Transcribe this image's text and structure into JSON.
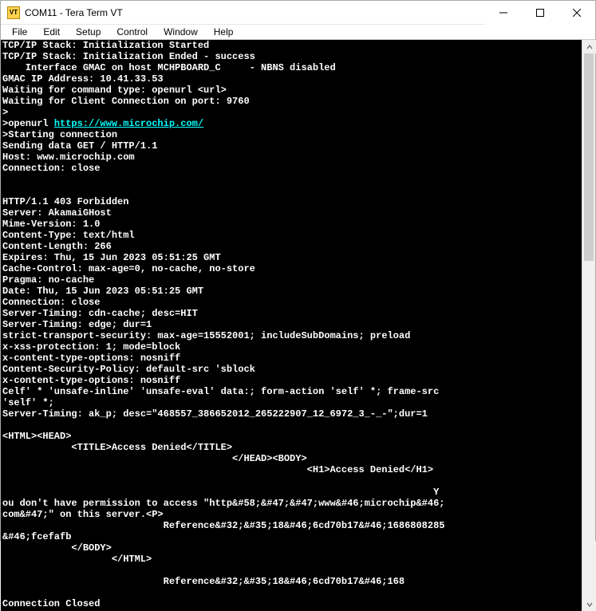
{
  "window": {
    "app_icon_label": "VT",
    "title": "COM11 - Tera Term VT"
  },
  "menu": {
    "items": [
      "File",
      "Edit",
      "Setup",
      "Control",
      "Window",
      "Help"
    ]
  },
  "terminal": {
    "pre1": "TCP/IP Stack: Initialization Started\nTCP/IP Stack: Initialization Ended - success\n    Interface GMAC on host MCHPBOARD_C     - NBNS disabled\nGMAC IP Address: 10.41.33.53\nWaiting for command type: openurl <url>\nWaiting for Client Connection on port: 9760\n>\n>openurl ",
    "link": "https://www.microchip.com/",
    "pre2": "\n>Starting connection\nSending data GET / HTTP/1.1\nHost: www.microchip.com\nConnection: close\n\n\nHTTP/1.1 403 Forbidden\nServer: AkamaiGHost\nMime-Version: 1.0\nContent-Type: text/html\nContent-Length: 266\nExpires: Thu, 15 Jun 2023 05:51:25 GMT\nCache-Control: max-age=0, no-cache, no-store\nPragma: no-cache\nDate: Thu, 15 Jun 2023 05:51:25 GMT\nConnection: close\nServer-Timing: cdn-cache; desc=HIT\nServer-Timing: edge; dur=1\nstrict-transport-security: max-age=15552001; includeSubDomains; preload\nx-xss-protection: 1; mode=block\nx-content-type-options: nosniff\nContent-Security-Policy: default-src 'sblock\nx-content-type-options: nosniff\nCelf' * 'unsafe-inline' 'unsafe-eval' data:; form-action 'self' *; frame-src\n'self' *;\nServer-Timing: ak_p; desc=\"468557_386652012_265222907_12_6972_3_-_-\";dur=1\n\n<HTML><HEAD>\n            <TITLE>Access Denied</TITLE>\n                                        </HEAD><BODY>\n                                                     <H1>Access Denied</H1>\n\n                                                                           Y\nou don't have permission to access \"http&#58;&#47;&#47;www&#46;microchip&#46;\ncom&#47;\" on this server.<P>\n                            Reference&#32;&#35;18&#46;6cd70b17&#46;1686808285\n&#46;fcefafb\n            </BODY>\n                   </HTML>\n\n                            Reference&#32;&#35;18&#46;6cd70b17&#46;168\n\nConnection Closed"
  }
}
